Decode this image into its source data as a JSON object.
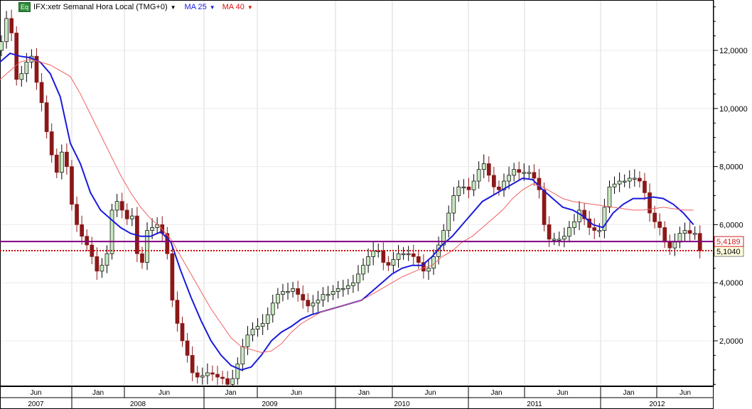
{
  "header": {
    "badge": "Eq",
    "title": "IFX:xetr Semanal Hora Local (TMG+0)",
    "ma25_label": "MA 25",
    "ma40_label": "MA 40",
    "dropdown_glyph": "▼"
  },
  "colors": {
    "ma25": "#1a1adc",
    "ma40": "#f06060",
    "up": "#c9e8c0",
    "down": "#8b1818",
    "last_line": "#800080",
    "prev_line": "#cc0000"
  },
  "price_tags": {
    "last": "5,4189",
    "last_value": 5.4189,
    "ref": "5,1040",
    "ref_value": 5.104
  },
  "chart_data": {
    "type": "candlestick",
    "title": "IFX:xetr Semanal Hora Local (TMG+0)",
    "start": "Jun 2007",
    "candle_interval": "2 weeks",
    "ma_interval": "4 weeks",
    "ylim": [
      0,
      13.5
    ],
    "y_ticks": [
      {
        "v": 2,
        "label": "2,0000"
      },
      {
        "v": 4,
        "label": "4,0000"
      },
      {
        "v": 6,
        "label": "6,0000"
      },
      {
        "v": 8,
        "label": "8,0000"
      },
      {
        "v": 10,
        "label": "10,0000"
      },
      {
        "v": 12,
        "label": "12,0000"
      }
    ],
    "month_labels": [
      "Jun",
      "Jan",
      "Jun",
      "Jan",
      "Jun",
      "Jan",
      "Jun",
      "Jan",
      "Jun",
      "Jan",
      "Jun"
    ],
    "year_labels": [
      "2007",
      "2008",
      "2009",
      "2010",
      "2011",
      "2012"
    ],
    "close": [
      12.3,
      13.1,
      12.6,
      11.0,
      11.2,
      11.6,
      11.8,
      10.9,
      10.2,
      9.2,
      8.4,
      7.8,
      8.5,
      8.0,
      6.7,
      6.0,
      5.6,
      5.3,
      4.9,
      4.4,
      4.6,
      5.0,
      6.5,
      6.8,
      6.5,
      6.2,
      6.3,
      5.0,
      4.7,
      5.8,
      5.9,
      6.0,
      5.7,
      5.0,
      3.4,
      2.6,
      2.0,
      1.5,
      0.9,
      0.75,
      0.8,
      0.9,
      0.85,
      0.75,
      0.7,
      0.5,
      0.7,
      1.2,
      1.8,
      2.2,
      2.4,
      2.5,
      2.6,
      2.9,
      3.3,
      3.6,
      3.7,
      3.7,
      3.8,
      3.6,
      3.4,
      3.2,
      3.3,
      3.4,
      3.6,
      3.6,
      3.7,
      3.8,
      3.8,
      3.9,
      4.0,
      4.3,
      4.6,
      4.9,
      5.1,
      5.1,
      4.7,
      4.6,
      4.8,
      5.0,
      5.0,
      5.0,
      4.9,
      4.7,
      4.4,
      4.5,
      4.9,
      5.3,
      5.8,
      6.4,
      7.0,
      7.3,
      7.3,
      7.2,
      7.5,
      7.9,
      8.1,
      7.7,
      7.3,
      7.2,
      7.5,
      7.7,
      7.9,
      7.8,
      7.8,
      7.8,
      7.6,
      7.2,
      6.0,
      5.5,
      5.5,
      5.5,
      5.6,
      5.9,
      6.1,
      6.5,
      6.2,
      5.9,
      5.8,
      5.8,
      6.6,
      7.3,
      7.4,
      7.5,
      7.5,
      7.6,
      7.6,
      7.5,
      7.1,
      6.4,
      6.1,
      5.9,
      5.4,
      5.2,
      5.4,
      5.7,
      5.8,
      5.7,
      5.7,
      5.1
    ],
    "series": [
      {
        "name": "MA 25",
        "values": [
          11.6,
          11.9,
          11.8,
          11.75,
          11.6,
          11.2,
          10.4,
          8.8,
          8.1,
          7.1,
          6.5,
          6.2,
          5.9,
          5.7,
          5.6,
          5.6,
          5.75,
          5.4,
          4.4,
          3.5,
          2.7,
          2.0,
          1.5,
          1.15,
          1.0,
          1.1,
          1.5,
          2.0,
          2.3,
          2.5,
          2.75,
          2.9,
          3.0,
          3.1,
          3.2,
          3.3,
          3.4,
          3.7,
          4.0,
          4.3,
          4.5,
          4.6,
          4.6,
          4.9,
          5.3,
          5.6,
          6.0,
          6.4,
          6.8,
          7.0,
          7.2,
          7.4,
          7.6,
          7.55,
          7.2,
          6.9,
          6.6,
          6.5,
          6.3,
          6.0,
          5.9,
          6.4,
          6.7,
          6.9,
          6.9,
          6.95,
          6.9,
          6.7,
          6.4,
          6.0
        ]
      },
      {
        "name": "MA 40",
        "values": [
          11.0,
          11.3,
          11.6,
          11.7,
          11.6,
          11.5,
          11.3,
          11.1,
          10.5,
          9.8,
          9.1,
          8.4,
          7.7,
          7.1,
          6.6,
          6.2,
          5.9,
          5.5,
          4.9,
          4.3,
          3.7,
          3.1,
          2.6,
          2.1,
          1.8,
          1.7,
          1.6,
          1.65,
          1.9,
          2.3,
          2.6,
          2.8,
          3.0,
          3.1,
          3.2,
          3.3,
          3.4,
          3.6,
          3.8,
          4.0,
          4.2,
          4.35,
          4.5,
          4.6,
          4.9,
          5.1,
          5.4,
          5.6,
          5.9,
          6.2,
          6.5,
          6.9,
          7.2,
          7.4,
          7.3,
          7.1,
          6.9,
          6.8,
          6.75,
          6.7,
          6.65,
          6.6,
          6.55,
          6.5,
          6.5,
          6.55,
          6.6,
          6.55,
          6.5,
          6.5
        ]
      }
    ]
  }
}
